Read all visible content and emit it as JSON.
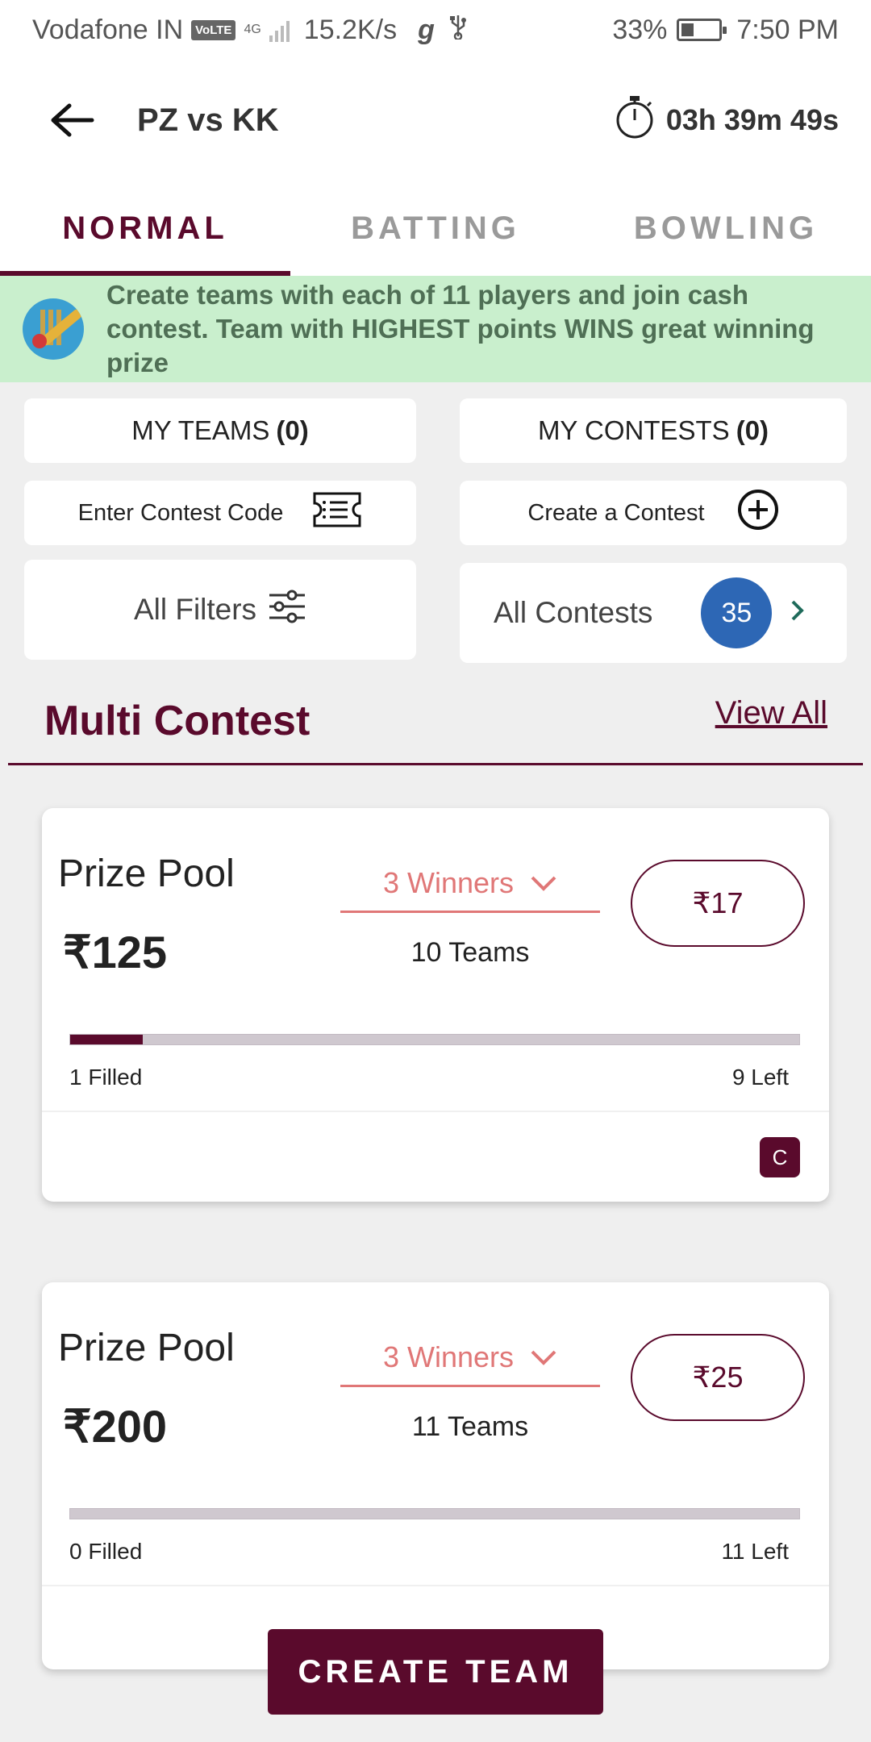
{
  "status_bar": {
    "carrier": "Vodafone IN",
    "volte": "VoLTE",
    "network": "4G",
    "speed": "15.2K/s",
    "battery_percent": "33%",
    "battery_level": 0.33,
    "time": "7:50 PM"
  },
  "header": {
    "title": "PZ vs KK",
    "timer": "03h 39m 49s"
  },
  "tabs": [
    {
      "label": "NORMAL",
      "active": true
    },
    {
      "label": "BATTING",
      "active": false
    },
    {
      "label": "BOWLING",
      "active": false
    }
  ],
  "banner": {
    "text": "Create teams with each of 11 players and join cash contest. Team with HIGHEST points WINS great winning prize"
  },
  "actions": {
    "my_teams_label": "MY TEAMS",
    "my_teams_count": "(0)",
    "my_contests_label": "MY CONTESTS",
    "my_contests_count": "(0)",
    "enter_code_label": "Enter Contest Code",
    "create_contest_label": "Create a Contest",
    "all_filters_label": "All Filters",
    "all_contests_label": "All Contests",
    "all_contests_count": "35"
  },
  "section": {
    "title": "Multi Contest",
    "view_all": "View All"
  },
  "contests": [
    {
      "prize_label": "Prize Pool",
      "prize": "₹125",
      "winners": "3 Winners",
      "teams": "10 Teams",
      "entry": "₹17",
      "filled_text": "1 Filled",
      "left_text": "9 Left",
      "fill_fraction": 0.1,
      "badge": "C"
    },
    {
      "prize_label": "Prize Pool",
      "prize": "₹200",
      "winners": "3 Winners",
      "teams": "11 Teams",
      "entry": "₹25",
      "filled_text": "0 Filled",
      "left_text": "11 Left",
      "fill_fraction": 0
    }
  ],
  "footer": {
    "create_team": "CREATE TEAM"
  },
  "colors": {
    "primary": "#5a0a2c",
    "accent_red": "#e07777",
    "banner_bg": "#c9efcd",
    "count_blue": "#2d67b5"
  }
}
